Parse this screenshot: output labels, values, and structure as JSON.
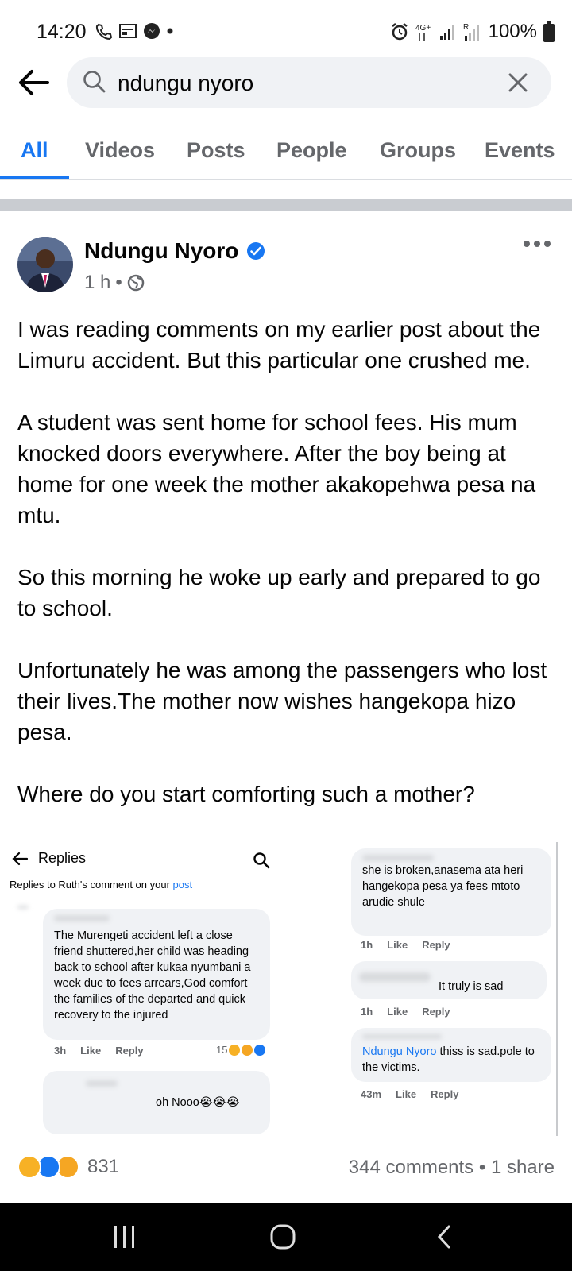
{
  "status_bar": {
    "time": "14:20",
    "network": "4G+",
    "battery": "100%"
  },
  "search": {
    "query": "ndungu nyoro"
  },
  "tabs": [
    {
      "label": "All",
      "active": true
    },
    {
      "label": "Videos",
      "active": false
    },
    {
      "label": "Posts",
      "active": false
    },
    {
      "label": "People",
      "active": false
    },
    {
      "label": "Groups",
      "active": false
    },
    {
      "label": "Events",
      "active": false
    }
  ],
  "post": {
    "author": "Ndungu Nyoro",
    "time": "1 h",
    "paragraphs": [
      "I was reading comments on my earlier post about the Limuru accident. But this particular one crushed me.",
      "A student was sent home for school fees. His mum knocked doors everywhere. After the boy being at home for one week the mother akakopehwa pesa na mtu.",
      "So this morning he woke up early and prepared to go to school.",
      "Unfortunately he was among the passengers who lost their lives.The mother now wishes hangekopa hizo pesa.",
      "Where do you start comforting such a mother?"
    ]
  },
  "embedded": {
    "replies_title": "Replies",
    "replies_sub_prefix": "Replies to Ruth's comment on your ",
    "replies_sub_link": "post",
    "comment1_text": "The Murengeti accident left a close friend shuttered,her child was heading back to school after kukaa nyumbani a week due to fees arrears,God comfort the families of the departed and quick recovery to the injured",
    "comment1_time": "3h",
    "comment1_reactions": "15",
    "comment2_text": "oh Nooo😭😭😭",
    "comment3_text": "she is broken,anasema ata heri hangekopa pesa ya fees mtoto arudie shule",
    "comment3_time": "1h",
    "comment4_text": "It truly is sad",
    "comment4_time": "1h",
    "comment5_name": "Ndungu Nyoro",
    "comment5_text": " thiss is sad.pole to the victims.",
    "comment5_time": "43m",
    "like_label": "Like",
    "reply_label": "Reply"
  },
  "reactions": {
    "count": "831",
    "comments": "344 comments",
    "shares": "1 share"
  },
  "colors": {
    "accent": "#1877f2",
    "secondary_text": "#65676b",
    "search_bg": "#f0f2f5"
  }
}
